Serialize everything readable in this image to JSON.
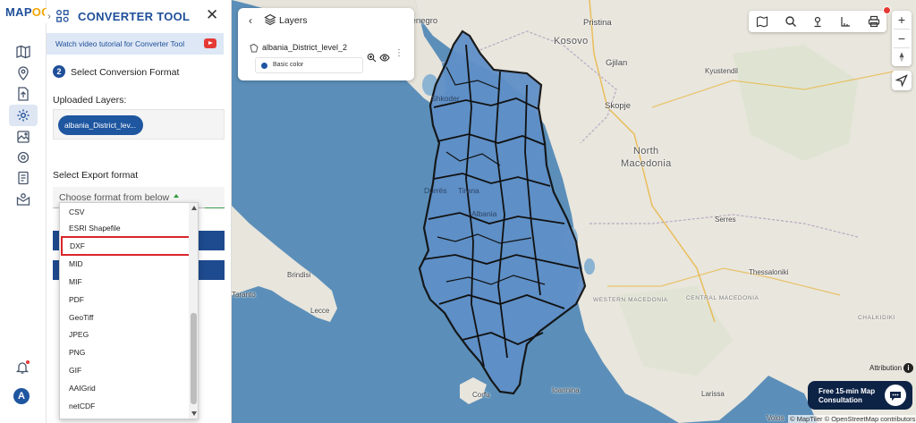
{
  "app": {
    "logo_main": "MAP",
    "logo_accent": "OG"
  },
  "rail": {
    "items": [
      "map-icon",
      "location-pin-icon",
      "upload-file-icon",
      "gear-icon",
      "image-layers-icon",
      "settings-cog-icon",
      "document-list-icon",
      "mail-user-icon"
    ],
    "active": "gear-icon",
    "avatar_letter": "A"
  },
  "panel": {
    "title": "CONVERTER TOOL",
    "tutorial": "Watch video tutorial for Converter Tool",
    "step_number": "2",
    "step_label": "Select Conversion Format",
    "uploaded_label": "Uploaded Layers:",
    "uploaded_layer": "albania_District_lev...",
    "export_label": "Select Export format",
    "export_placeholder": "Choose format from below"
  },
  "dropdown": {
    "options": [
      "CSV",
      "ESRI Shapefile",
      "DXF",
      "MID",
      "MIF",
      "PDF",
      "GeoTiff",
      "JPEG",
      "PNG",
      "GIF",
      "AAIGrid",
      "netCDF"
    ],
    "highlighted": "DXF"
  },
  "layers_panel": {
    "title": "Layers",
    "layer_name": "albania_District_level_2",
    "style_label": "Basic color",
    "style_color": "#1e56a0"
  },
  "map": {
    "labels": {
      "montenegro": "tenegro",
      "pristina": "Pristina",
      "kosovo": "Kosovo",
      "gjilan": "Gjilan",
      "kyustendil": "Kyustendil",
      "shkoder": "Shkoder",
      "skopje": "Skopje",
      "north_macedonia_1": "North",
      "north_macedonia_2": "Macedonia",
      "durres": "Durrës",
      "tirana": "Tirana",
      "albania": "Albania",
      "serres": "Serres",
      "brindisi": "Brindisi",
      "lecce": "Lecce",
      "thessaloniki": "Thessaloniki",
      "taranto": "Taranto",
      "western_macedonia": "WESTERN MACEDONIA",
      "central_macedonia": "CENTRAL MACEDONIA",
      "chalkidiki": "CHALKIDIKI",
      "corfu": "Corfu",
      "ioannina": "Ioannina",
      "larissa": "Larissa",
      "volos": "Volos"
    },
    "attribution": "Attribution",
    "credits": "© MapTiler © OpenStreetMap contributors",
    "consult": "Free 15-min Map Consultation",
    "zoom_in": "+",
    "zoom_out": "−"
  },
  "colors": {
    "brand": "#1f4f99",
    "accent": "#f2a600",
    "primary_button": "#1e4a8f",
    "highlight_border": "#d9262b",
    "district_fill": "#5f8fc7",
    "sea": "#5b8fb9"
  }
}
